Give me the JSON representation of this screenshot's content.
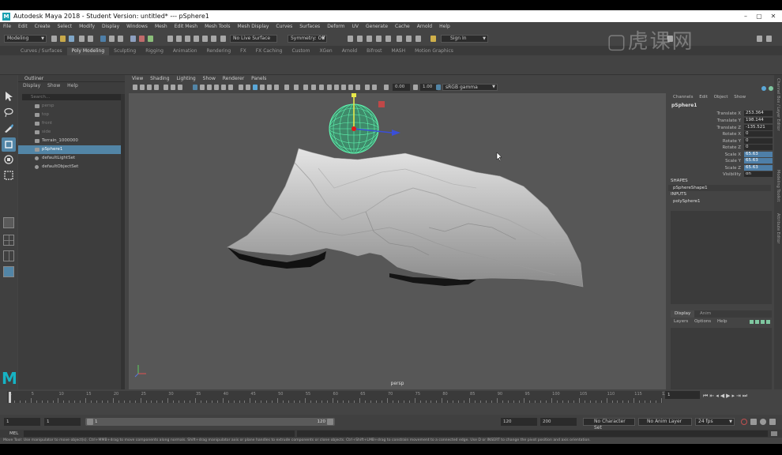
{
  "window": {
    "title": "Autodesk Maya 2018 - Student Version: untitled*  ---  pSphere1",
    "app_icon": "M"
  },
  "menubar": [
    "File",
    "Edit",
    "Create",
    "Select",
    "Modify",
    "Display",
    "Windows",
    "Mesh",
    "Edit Mesh",
    "Mesh Tools",
    "Mesh Display",
    "Curves",
    "Surfaces",
    "Deform",
    "UV",
    "Generate",
    "Cache",
    "Arnold",
    "Help"
  ],
  "statusline": {
    "mode": "Modeling",
    "live_surface": "No Live Surface",
    "symmetry": "Symmetry: Off",
    "sign_in": "Sign In"
  },
  "shelf_tabs": [
    "Curves / Surfaces",
    "Poly Modeling",
    "Sculpting",
    "Rigging",
    "Animation",
    "Rendering",
    "FX",
    "FX Caching",
    "Custom",
    "XGen",
    "Arnold",
    "Bifrost",
    "MASH",
    "Motion Graphics"
  ],
  "shelf_active": "Poly Modeling",
  "outliner": {
    "title": "Outliner",
    "menu": [
      "Display",
      "Show",
      "Help"
    ],
    "search_placeholder": "Search...",
    "items": [
      {
        "label": "persp",
        "state": "dim",
        "icon": "camera-icon"
      },
      {
        "label": "top",
        "state": "dim",
        "icon": "camera-icon"
      },
      {
        "label": "front",
        "state": "dim",
        "icon": "camera-icon"
      },
      {
        "label": "side",
        "state": "dim",
        "icon": "camera-icon"
      },
      {
        "label": "Terrain_1000000",
        "state": "normal",
        "icon": "transform-icon"
      },
      {
        "label": "pSphere1",
        "state": "selected",
        "icon": "transform-icon"
      },
      {
        "label": "defaultLightSet",
        "state": "normal",
        "icon": "set-icon"
      },
      {
        "label": "defaultObjectSet",
        "state": "normal",
        "icon": "set-icon"
      }
    ]
  },
  "viewport": {
    "menu": [
      "View",
      "Shading",
      "Lighting",
      "Show",
      "Renderer",
      "Panels"
    ],
    "exposure": "0.00",
    "gamma": "1.00",
    "color_space": "sRGB gamma",
    "camera_label": "persp"
  },
  "channel_box": {
    "tabs": [
      "Channels",
      "Edit",
      "Object",
      "Show"
    ],
    "object": "pSphere1",
    "attributes": [
      {
        "name": "Translate X",
        "value": "253.364",
        "highlight": false
      },
      {
        "name": "Translate Y",
        "value": "198.144",
        "highlight": false
      },
      {
        "name": "Translate Z",
        "value": "-135.521",
        "highlight": false
      },
      {
        "name": "Rotate X",
        "value": "0",
        "highlight": false
      },
      {
        "name": "Rotate Y",
        "value": "0",
        "highlight": false
      },
      {
        "name": "Rotate Z",
        "value": "0",
        "highlight": false
      },
      {
        "name": "Scale X",
        "value": "65.63",
        "highlight": true
      },
      {
        "name": "Scale Y",
        "value": "65.63",
        "highlight": true
      },
      {
        "name": "Scale Z",
        "value": "65.63",
        "highlight": true
      },
      {
        "name": "Visibility",
        "value": "on",
        "highlight": false
      }
    ],
    "shapes_header": "SHAPES",
    "shape": "pSphereShape1",
    "inputs_header": "INPUTS",
    "input": "polySphere1"
  },
  "layer_editor": {
    "tabs": [
      "Display",
      "Anim"
    ],
    "menu": [
      "Layers",
      "Options",
      "Help"
    ]
  },
  "side_strip": [
    "Channel Box / Layer Editor",
    "Modeling Toolkit",
    "Attribute Editor"
  ],
  "timeline": {
    "ticks": [
      "1",
      "5",
      "10",
      "15",
      "20",
      "25",
      "30",
      "35",
      "40",
      "45",
      "50",
      "55",
      "60",
      "65",
      "70",
      "75",
      "80",
      "85",
      "90",
      "95",
      "100",
      "105",
      "110",
      "115",
      "120"
    ],
    "current_frame": "1"
  },
  "range": {
    "start": "1",
    "range_start": "1",
    "range_slider_start": "1",
    "range_slider_end": "120",
    "range_end": "120",
    "end": "200",
    "character_set": "No Character Set",
    "anim_layer": "No Anim Layer",
    "fps": "24 fps"
  },
  "command": {
    "label": "MEL"
  },
  "help_line": "Move Tool: Use manipulator to move object(s). Ctrl+MMB+drag to move components along normals. Shift+drag manipulator axis or plane handles to extrude components or clone objects. Ctrl+Shift+LMB+drag to constrain movement to a connected edge. Use D or INSERT to change the pivot position and axis orientation."
}
